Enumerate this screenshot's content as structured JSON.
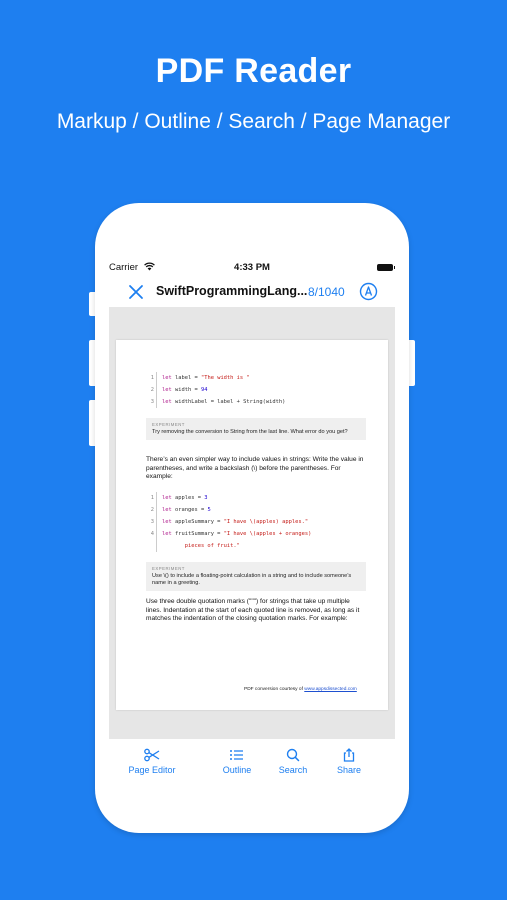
{
  "promo": {
    "title": "PDF Reader",
    "subtitle": "Markup / Outline / Search / Page Manager"
  },
  "statusbar": {
    "carrier": "Carrier",
    "time": "4:33 PM"
  },
  "navbar": {
    "doc_title": "SwiftProgrammingLang...",
    "page_counter": "8/1040"
  },
  "pdf": {
    "code_block_1": [
      {
        "n": "1",
        "code_html": "<span class='kw'>let</span> label = <span class='str'>\"The width is \"</span>"
      },
      {
        "n": "2",
        "code_html": "<span class='kw'>let</span> width = <span class='num'>94</span>"
      },
      {
        "n": "3",
        "code_html": "<span class='kw'>let</span> widthLabel = label + String(width)"
      }
    ],
    "experiment_1": {
      "label": "EXPERIMENT",
      "text": "Try removing the conversion to String from the last line. What error do you get?"
    },
    "para_1": "There’s an even simpler way to include values in strings: Write the value in parentheses, and write a backslash (\\) before the parentheses. For example:",
    "code_block_2": [
      {
        "n": "1",
        "code_html": "<span class='kw'>let</span> apples = <span class='num'>3</span>"
      },
      {
        "n": "2",
        "code_html": "<span class='kw'>let</span> oranges = <span class='num'>5</span>"
      },
      {
        "n": "3",
        "code_html": "<span class='kw'>let</span> appleSummary = <span class='str'>\"I have \\(apples) apples.\"</span>"
      },
      {
        "n": "4",
        "code_html": "<span class='kw'>let</span> fruitSummary = <span class='str'>\"I have \\(apples + oranges)</span>"
      },
      {
        "n": "",
        "code_html": "&nbsp;&nbsp;&nbsp;&nbsp;&nbsp;&nbsp;&nbsp;<span class='str'>pieces of fruit.\"</span>"
      }
    ],
    "experiment_2": {
      "label": "EXPERIMENT",
      "text": "Use \\() to include a floating-point calculation in a string and to include someone’s name in a greeting."
    },
    "para_2": "Use three double quotation marks (\"\"\") for strings that take up multiple lines. Indentation at the start of each quoted line is removed, as long as it matches the indentation of the closing quotation marks. For example:",
    "footer_prefix": "PDF conversion courtesy of ",
    "footer_link": "www.appsdissected.com"
  },
  "tabbar": {
    "page_editor": "Page Editor",
    "outline": "Outline",
    "search": "Search",
    "share": "Share"
  },
  "colors": {
    "accent": "#1E7FF0",
    "background": "#1E7FF0"
  },
  "icons": [
    "close-icon",
    "annotate-icon",
    "scissors-icon",
    "list-icon",
    "search-icon",
    "share-icon",
    "wifi-icon",
    "battery-icon"
  ]
}
